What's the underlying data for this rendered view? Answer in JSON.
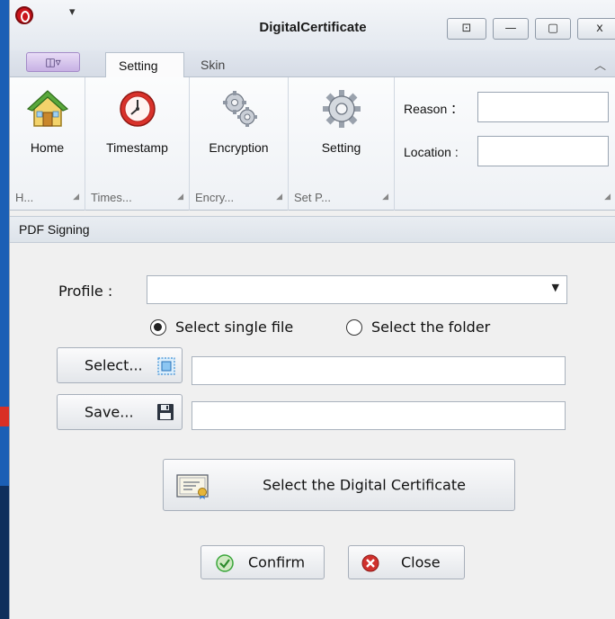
{
  "window": {
    "title": "DigitalCertificate",
    "qat_dropdown": "▾",
    "controls": {
      "restore": "⊡",
      "minimize": "—",
      "maximize": "▢",
      "close": "x"
    }
  },
  "tabs": {
    "app_menu": "◫▿",
    "items": [
      {
        "label": "Setting",
        "active": true
      },
      {
        "label": "Skin",
        "active": false
      }
    ],
    "collapse": "︿"
  },
  "ribbon": {
    "groups": [
      {
        "button": "Home",
        "group_label": "H...",
        "icon": "home-icon"
      },
      {
        "button": "Timestamp",
        "group_label": "Times...",
        "icon": "clock-icon"
      },
      {
        "button": "Encryption",
        "group_label": "Encry...",
        "icon": "gears-icon"
      },
      {
        "button": "Setting",
        "group_label": "Set P...",
        "icon": "gear-icon"
      }
    ],
    "launcher": "◢",
    "fields": {
      "reason_label": "Reason ：",
      "reason_value": "",
      "location_label": "Location :",
      "location_value": ""
    }
  },
  "pdf_signing": {
    "header": "PDF Signing",
    "profile_label": "Profile :",
    "profile_value": "",
    "profile_caret": "▼",
    "radio_single": "Select single file",
    "radio_folder": "Select the folder",
    "radio_selected": "single",
    "select_button": "Select...",
    "select_path": "",
    "save_button": "Save...",
    "save_path": "",
    "certificate_button": "Select the Digital Certificate",
    "confirm_button": "Confirm",
    "close_button": "Close"
  },
  "colors": {
    "accent": "#1b5fb5",
    "confirm_green": "#3aa63a",
    "close_red": "#d0312d",
    "clock_red": "#d9322b"
  }
}
